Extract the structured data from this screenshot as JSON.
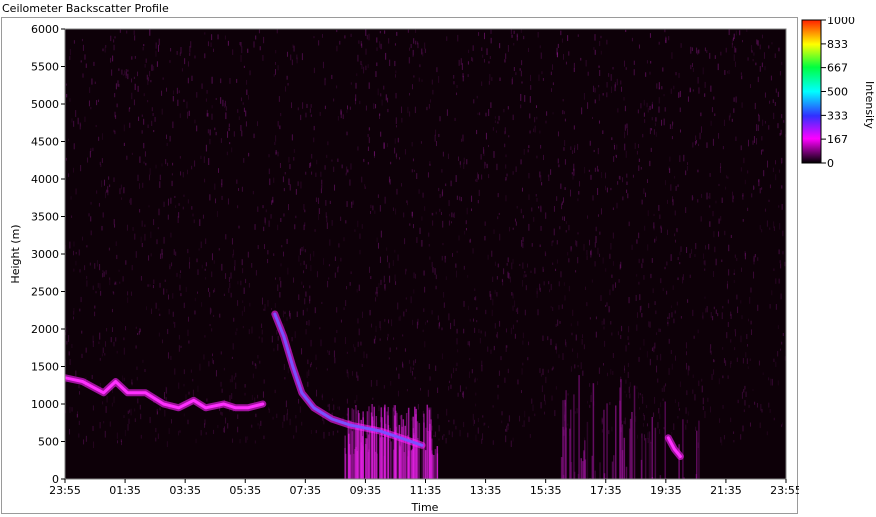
{
  "window": {
    "title": "Ceilometer Backscatter Profile"
  },
  "chart_data": {
    "type": "heatmap",
    "xlabel": "Time",
    "ylabel": "Height (m)",
    "x_ticks": [
      "23:55",
      "01:35",
      "03:35",
      "05:35",
      "07:35",
      "09:35",
      "11:35",
      "13:35",
      "15:35",
      "17:35",
      "19:35",
      "21:35",
      "23:55"
    ],
    "y_ticks": [
      0,
      500,
      1000,
      1500,
      2000,
      2500,
      3000,
      3500,
      4000,
      4500,
      5000,
      5500,
      6000
    ],
    "ylim": [
      0,
      6000
    ],
    "xlim_hours": [
      -0.0833,
      23.9167
    ],
    "colorbar": {
      "label": "Intensity",
      "ticks": [
        0,
        167,
        333,
        500,
        667,
        833,
        1000
      ],
      "tick_labels": [
        "0",
        "167",
        "333",
        "500",
        "667",
        "833",
        "1000"
      ],
      "range": [
        0,
        1000
      ]
    },
    "layers": [
      {
        "t": [
          -0.08,
          0.5,
          1.2,
          1.6,
          2.0,
          2.6,
          3.2,
          3.7,
          4.2,
          4.6,
          5.2,
          5.6,
          6.0,
          6.5
        ],
        "h": [
          1350,
          1300,
          1150,
          1300,
          1150,
          1150,
          1000,
          950,
          1050,
          950,
          1000,
          950,
          950,
          1000
        ],
        "intensity": 250
      },
      {
        "t": [
          6.9,
          7.2,
          7.5,
          7.8,
          8.2,
          8.8,
          9.4,
          9.9,
          10.4,
          11.0,
          11.8
        ],
        "h": [
          2200,
          1900,
          1500,
          1150,
          950,
          800,
          720,
          680,
          640,
          560,
          450
        ],
        "intensity": 450
      },
      {
        "t": [
          20.0,
          20.2,
          20.4
        ],
        "h": [
          550,
          400,
          300
        ],
        "intensity": 350
      }
    ]
  }
}
